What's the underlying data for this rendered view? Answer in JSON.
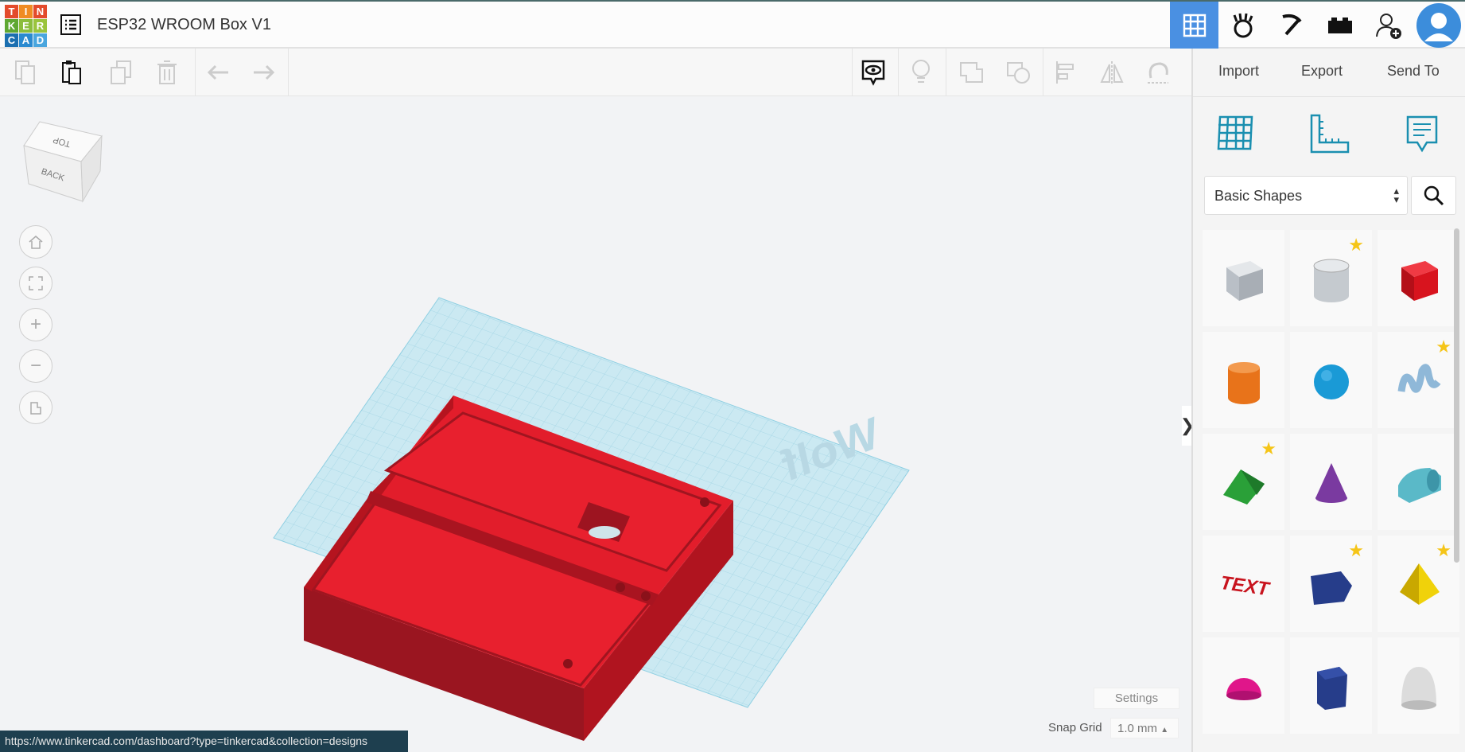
{
  "app": {
    "logo_letters": [
      "T",
      "I",
      "N",
      "K",
      "E",
      "R",
      "C",
      "A",
      "D"
    ],
    "title": "ESP32 WROOM Box V1"
  },
  "header_icons": [
    "3d-design-grid-icon",
    "hand-sim-icon",
    "pickaxe-icon",
    "bricks-icon",
    "add-user-icon",
    "avatar"
  ],
  "toolbar": {
    "left": [
      "copy-icon",
      "paste-icon",
      "duplicate-icon",
      "trash-icon",
      "undo-icon",
      "redo-icon"
    ],
    "right": [
      "show-hide-icon",
      "light-bulb-icon",
      "group-icon",
      "ungroup-icon",
      "align-icon",
      "mirror-icon",
      "cruise-icon"
    ],
    "import": "Import",
    "export": "Export",
    "send_to": "Send To"
  },
  "panel": {
    "tabs": [
      "workplane-grid-icon",
      "ruler-icon",
      "notes-icon"
    ],
    "category": "Basic Shapes",
    "shapes": [
      {
        "name": "box-hole",
        "color": "#b9bfc6",
        "star": false
      },
      {
        "name": "cylinder-hole",
        "color": "#c5cacf",
        "star": true
      },
      {
        "name": "box",
        "color": "#d8141e",
        "star": false
      },
      {
        "name": "cylinder",
        "color": "#e8731a",
        "star": false
      },
      {
        "name": "sphere",
        "color": "#1a9ad6",
        "star": false
      },
      {
        "name": "scribble",
        "color": "#8fb8d8",
        "star": true
      },
      {
        "name": "roof",
        "color": "#2aa038",
        "star": true
      },
      {
        "name": "cone",
        "color": "#7a3aa0",
        "star": false
      },
      {
        "name": "round-roof",
        "color": "#5ab9c8",
        "star": false
      },
      {
        "name": "text",
        "color": "#c8141e",
        "star": false
      },
      {
        "name": "polygon-prism",
        "color": "#263d8a",
        "star": true
      },
      {
        "name": "pyramid",
        "color": "#f0d20a",
        "star": true
      },
      {
        "name": "half-sphere",
        "color": "#e0168a",
        "star": false
      },
      {
        "name": "polygon",
        "color": "#263d8a",
        "star": false
      },
      {
        "name": "paraboloid",
        "color": "#dcdcdc",
        "star": false
      }
    ]
  },
  "viewcube": {
    "top": "TOP",
    "back": "BACK"
  },
  "settings": "Settings",
  "snap_grid": {
    "label": "Snap Grid",
    "value": "1.0 mm"
  },
  "status_url": "https://www.tinkercad.com/dashboard?type=tinkercad&collection=designs",
  "colors": {
    "accent": "#3c8ddb",
    "model": "#e21d2b",
    "status_bg": "#1e3f4f"
  }
}
